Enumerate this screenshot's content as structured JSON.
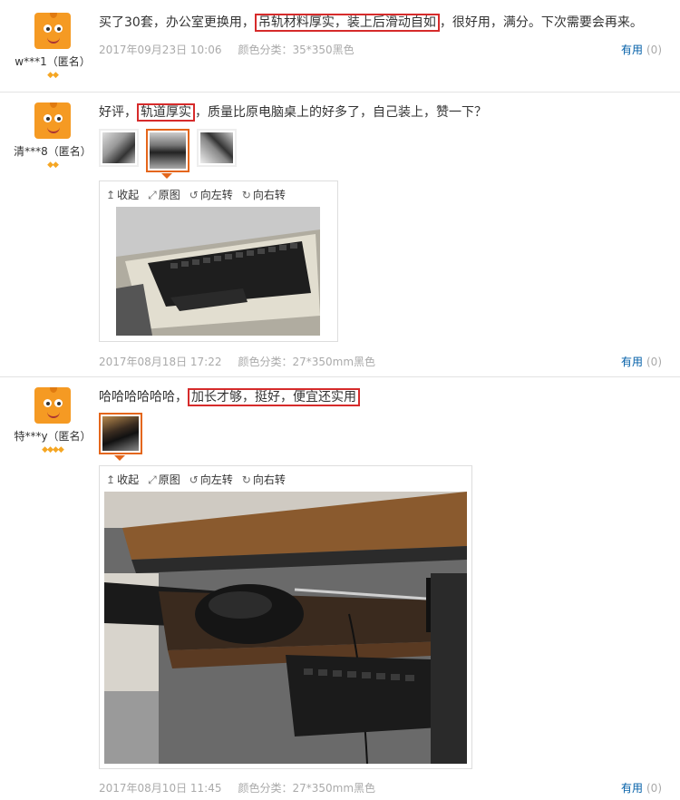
{
  "reviews": [
    {
      "user": "w***1（匿名）",
      "text_before": "买了30套，办公室更换用，",
      "highlight": "吊轨材料厚实，装上后滑动自如",
      "text_after": "，很好用，满分。下次需要会再来。",
      "date": "2017年09月23日 10:06",
      "color_label": "颜色分类：",
      "color_value": "35*350黑色",
      "useful_label": "有用",
      "useful_count": "(0)",
      "level": "◆◆"
    },
    {
      "user": "清***8（匿名）",
      "text_before": "好评，",
      "highlight": "轨道厚实",
      "text_after": "，质量比原电脑桌上的好多了，自己装上，赞一下？",
      "date": "2017年08月18日 17:22",
      "color_label": "颜色分类：",
      "color_value": "27*350mm黑色",
      "useful_label": "有用",
      "useful_count": "(0)",
      "level": "◆◆"
    },
    {
      "user": "特***y（匿名）",
      "text_before": "哈哈哈哈哈哈，",
      "highlight": "加长才够，挺好，便宜还实用",
      "text_after": "",
      "date": "2017年08月10日 11:45",
      "color_label": "颜色分类：",
      "color_value": "27*350mm黑色",
      "useful_label": "有用",
      "useful_count": "(0)",
      "level": "◆◆◆◆"
    }
  ],
  "viewer_tools": {
    "collapse": "收起",
    "original": "原图",
    "rotate_left": "向左转",
    "rotate_right": "向右转"
  },
  "colors": {
    "accent": "#e4661b",
    "highlight_border": "#d62b2b",
    "link": "#005ea7"
  }
}
